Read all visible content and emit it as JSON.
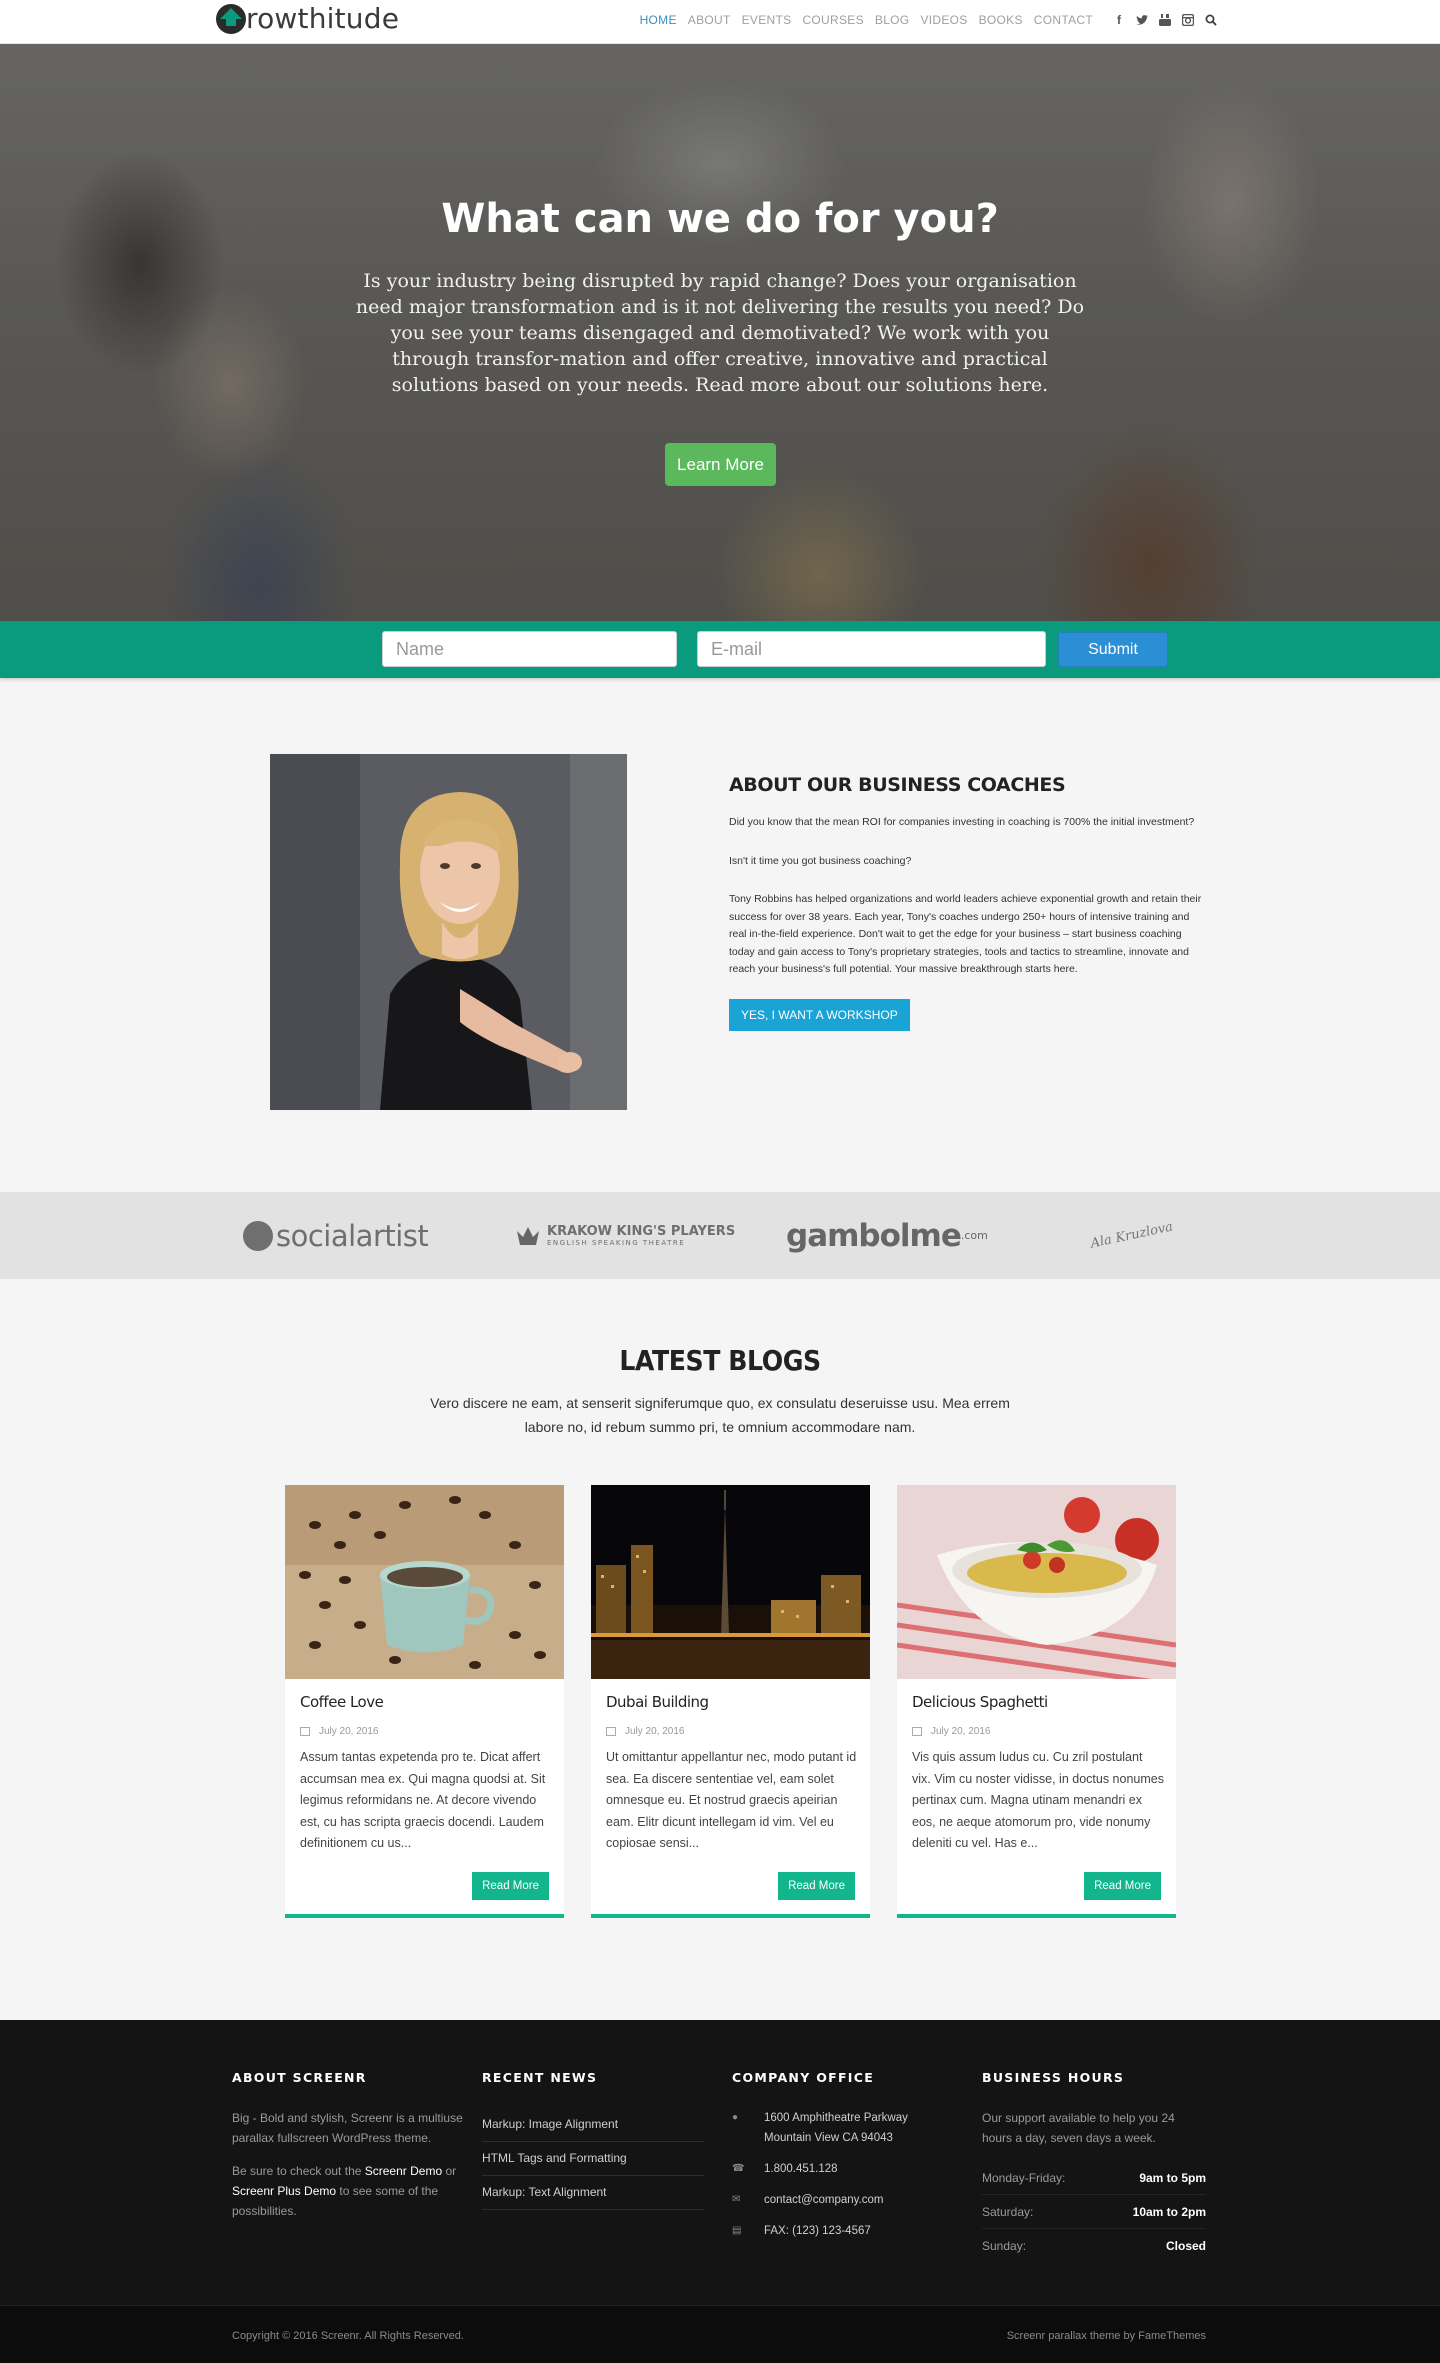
{
  "header": {
    "logo_text": "rowthitude",
    "logo_letter": "G",
    "nav": [
      "HOME",
      "ABOUT",
      "EVENTS",
      "COURSES",
      "BLOG",
      "VIDEOS",
      "BOOKS",
      "CONTACT"
    ],
    "social_icons": [
      "facebook-icon",
      "twitter-icon",
      "youtube-icon",
      "instagram-icon",
      "search-icon"
    ]
  },
  "hero": {
    "title": "What can we do for you?",
    "text": "Is your industry being disrupted by rapid change? Does your organisation need major transformation and is it not delivering the results you need? Do you see your teams disengaged and demotivated? We work with you through transfor-mation and offer creative, innovative and practical solutions based on your needs. Read more about our solutions here.",
    "button": "Learn More"
  },
  "subscribe": {
    "name_placeholder": "Name",
    "email_placeholder": "E-mail",
    "submit": "Submit"
  },
  "about": {
    "title": "ABOUT OUR BUSINESS COACHES",
    "p1": "Did you know that the mean ROI for companies investing in coaching is 700% the initial investment?",
    "p2": "Isn't it time you got business coaching?",
    "p3": "Tony Robbins has helped organizations and world leaders achieve exponential growth and retain their success for over 38 years. Each year, Tony's coaches undergo 250+ hours of intensive training and real in-the-field experience. Don't wait to get the edge for your business – start business coaching today and gain access to Tony's proprietary strategies, tools and tactics to streamline, innovate and reach your business's full potential. Your massive breakthrough starts here.",
    "button": "YES, I WANT A WORKSHOP"
  },
  "logos": {
    "l1": "socialartist",
    "l2_title": "KRAKOW KING'S PLAYERS",
    "l2_sub": "ENGLISH SPEAKING THEATRE",
    "l3": "gambolme",
    "l3_suffix": ".com",
    "l4": "Ala Kruzlova"
  },
  "blogs": {
    "title": "LATEST BLOGS",
    "intro": "Vero discere ne eam, at senserit signiferumque quo, ex consulatu deseruisse usu. Mea errem labore no, id rebum summo pri, te omnium accommodare nam.",
    "posts": [
      {
        "title": "Coffee Love",
        "date": "July 20, 2016",
        "excerpt": "Assum tantas expetenda pro te. Dicat affert accumsan mea ex. Qui magna quodsi at. Sit legimus reformidans ne. At decore vivendo est, cu has scripta graecis docendi. Laudem definitionem cu us...",
        "button": "Read More"
      },
      {
        "title": "Dubai Building",
        "date": "July 20, 2016",
        "excerpt": "Ut omittantur appellantur nec, modo putant id sea. Ea discere sententiae vel, eam solet omnesque eu. Et nostrud graecis apeirian eam. Elitr dicunt intellegam id vim. Vel eu copiosae sensi...",
        "button": "Read More"
      },
      {
        "title": "Delicious Spaghetti",
        "date": "July 20, 2016",
        "excerpt": "Vis quis assum ludus cu. Cu zril postulant vix. Vim cu noster vidisse, in doctus nonumes pertinax cum. Magna utinam menandri ex eos, ne aeque atomorum pro, vide nonumy deleniti cu vel. Has e...",
        "button": "Read More"
      }
    ]
  },
  "footer": {
    "about_title": "ABOUT SCREENR",
    "about_p1": "Big - Bold and stylish, Screenr is a multiuse parallax fullscreen WordPress theme.",
    "about_p2_pre": "Be sure to check out the ",
    "about_p2_link1": "Screenr Demo",
    "about_p2_mid": " or ",
    "about_p2_link2": "Screenr Plus Demo",
    "about_p2_post": " to see some of the possibilities.",
    "news_title": "RECENT NEWS",
    "news": [
      "Markup: Image Alignment",
      "HTML Tags and Formatting",
      "Markup: Text Alignment"
    ],
    "office_title": "COMPANY OFFICE",
    "address1": "1600 Amphitheatre Parkway",
    "address2": "Mountain View CA 94043",
    "phone": "1.800.451.128",
    "email": "contact@company.com",
    "fax": "FAX: (123) 123-4567",
    "hours_title": "BUSINESS HOURS",
    "hours_intro": "Our support available to help you 24 hours a day, seven days a week.",
    "hours": [
      {
        "day": "Monday-Friday:",
        "time": "9am to 5pm"
      },
      {
        "day": "Saturday:",
        "time": "10am to 2pm"
      },
      {
        "day": "Sunday:",
        "time": "Closed"
      }
    ],
    "copyright": "Copyright © 2016 Screenr. All Rights Reserved.",
    "credit": "Screenr parallax theme by FameThemes"
  },
  "colors": {
    "accent_green": "#0a9b7e",
    "button_green": "#12b58c",
    "nav_active": "#3b8dbd",
    "workshop_blue": "#1aa4d6",
    "submit_blue": "#2a8fd4"
  }
}
